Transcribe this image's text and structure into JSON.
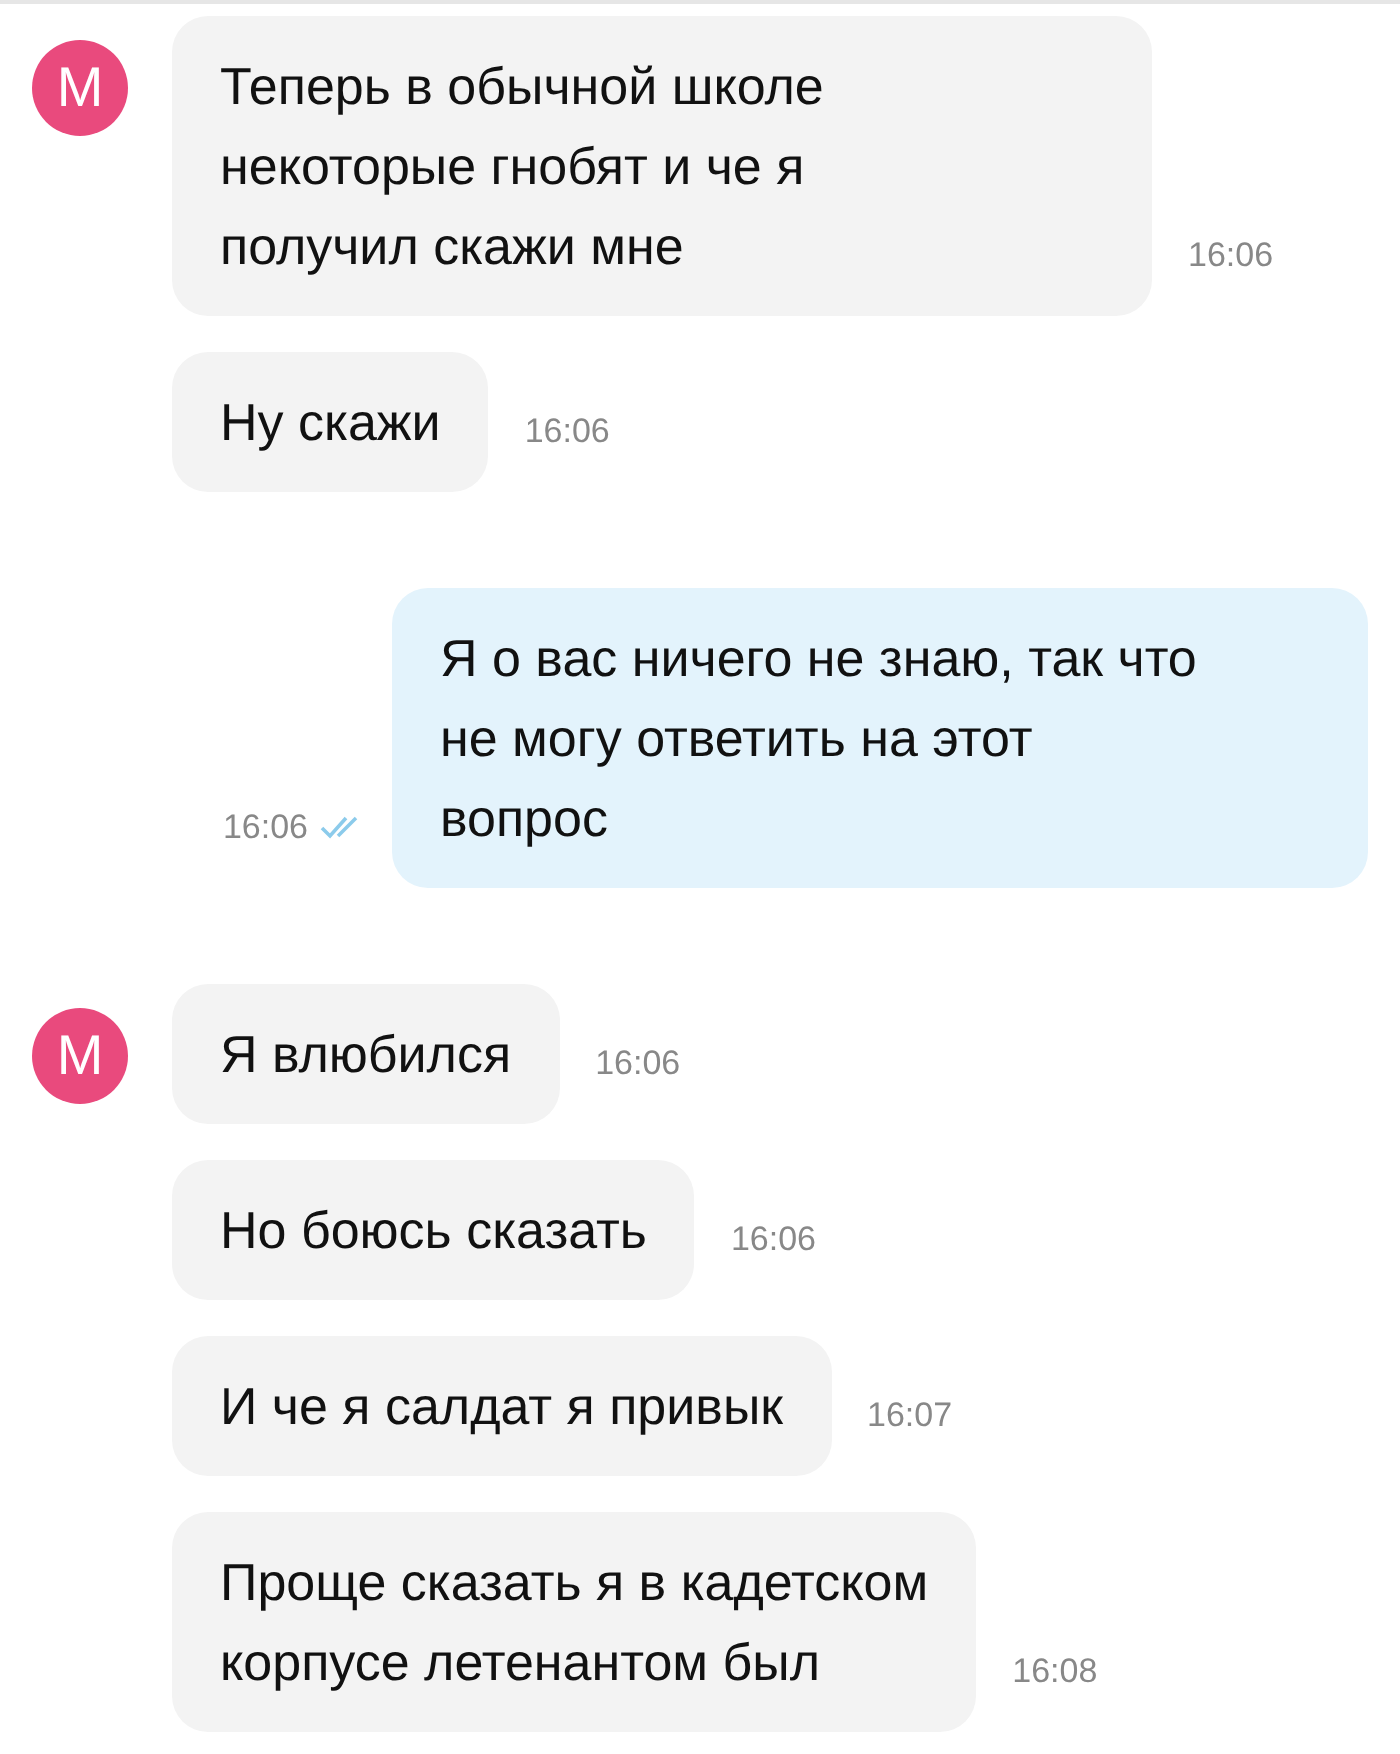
{
  "messages": [
    {
      "kind": "incoming",
      "avatar": "M",
      "text": "Теперь в обычной школе\nнекоторые гнобят и че я\nполучил скажи мне",
      "time": "16:06"
    },
    {
      "kind": "incoming",
      "text": "Ну скажи",
      "time": "16:06"
    },
    {
      "kind": "outgoing",
      "text": "Я о вас ничего не знаю, так что\nне могу ответить на этот\nвопрос",
      "time": "16:06",
      "read": true
    },
    {
      "kind": "incoming",
      "avatar": "M",
      "text": "Я влюбился",
      "time": "16:06"
    },
    {
      "kind": "incoming",
      "text": "Но боюсь сказать",
      "time": "16:06"
    },
    {
      "kind": "incoming",
      "text": "И че я салдат я привык",
      "time": "16:07"
    },
    {
      "kind": "incoming",
      "text": "Проще сказать я в кадетском\nкорпусе летенантом был",
      "time": "16:08"
    }
  ]
}
